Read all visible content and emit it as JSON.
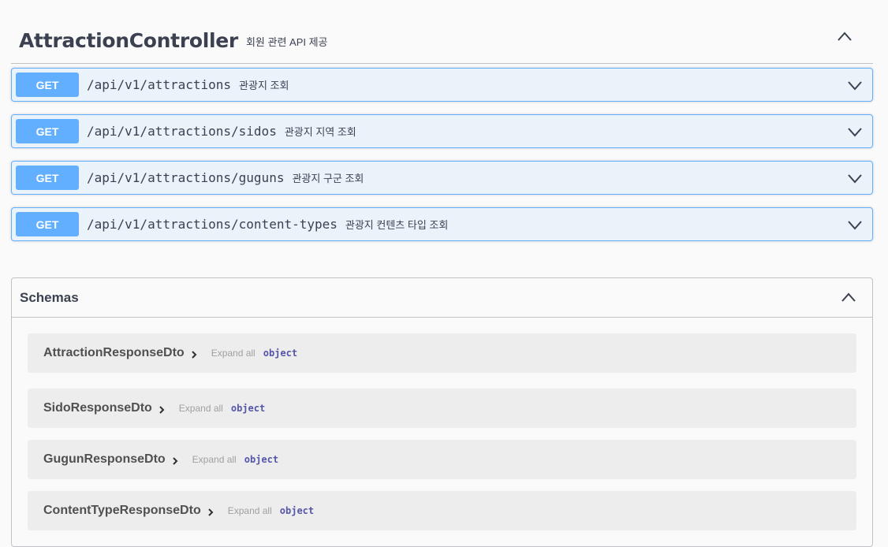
{
  "tag": {
    "title": "AttractionController",
    "description": "회원 관련 API 제공"
  },
  "operations": [
    {
      "method": "GET",
      "path": "/api/v1/attractions",
      "summary": "관광지 조회"
    },
    {
      "method": "GET",
      "path": "/api/v1/attractions/sidos",
      "summary": "관광지 지역 조회"
    },
    {
      "method": "GET",
      "path": "/api/v1/attractions/guguns",
      "summary": "관광지 구군 조회"
    },
    {
      "method": "GET",
      "path": "/api/v1/attractions/content-types",
      "summary": "관광지 컨텐츠 타입 조회"
    }
  ],
  "schemas": {
    "title": "Schemas",
    "items": [
      {
        "name": "AttractionResponseDto",
        "expand": "Expand all",
        "type": "object"
      },
      {
        "name": "SidoResponseDto",
        "expand": "Expand all",
        "type": "object"
      },
      {
        "name": "GugunResponseDto",
        "expand": "Expand all",
        "type": "object"
      },
      {
        "name": "ContentTypeResponseDto",
        "expand": "Expand all",
        "type": "object"
      }
    ]
  },
  "colors": {
    "get_accent": "#61affe",
    "object_type": "#5555aa"
  }
}
